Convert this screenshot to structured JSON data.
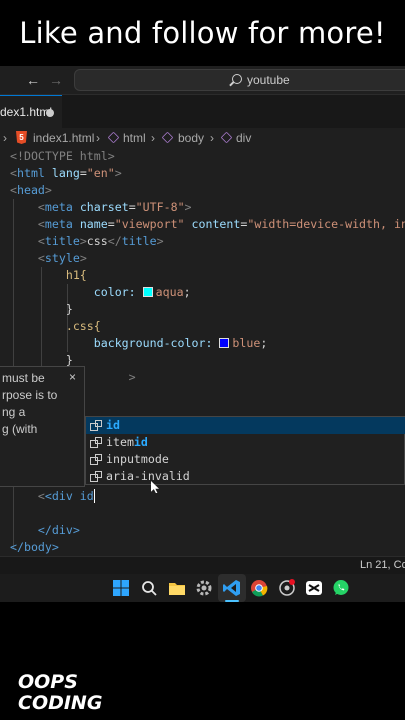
{
  "banner": {
    "text": "Like and follow for more!"
  },
  "titlebar": {
    "search_text": "youtube"
  },
  "tab": {
    "label": "dex1.html"
  },
  "breadcrumb": {
    "file": "index1.html",
    "items": [
      "html",
      "body",
      "div"
    ]
  },
  "code": {
    "doctype": "<!DOCTYPE html>",
    "html_lang": "en",
    "charset": "UTF-8",
    "viewport": "viewport",
    "viewport_content": "width=device-width, in",
    "title": "css",
    "h1_selector": "h1{",
    "h1_prop": "color:",
    "h1_value": "aqua",
    "css_selector": ".css{",
    "css_prop": "background-color:",
    "css_value": "blue",
    "div_line": "<div id",
    "div_close": "</div>",
    "body_close": "</body>"
  },
  "hover": {
    "lines": [
      "must be",
      "rpose is to",
      "ng a",
      "g (with"
    ],
    "close": "×"
  },
  "suggestions": [
    {
      "pre": "",
      "hl": "id",
      "post": ""
    },
    {
      "pre": "item",
      "hl": "id",
      "post": ""
    },
    {
      "pre": "inputmode",
      "hl": "",
      "post": ""
    },
    {
      "pre": "aria-in",
      "hl": "",
      "post": "valid"
    }
  ],
  "status": {
    "position": "Ln 21, Co"
  },
  "brand": {
    "line1": "OOPS",
    "line2": "CODING"
  },
  "colors": {
    "accent": "#0078d4",
    "aqua": "#00ffff",
    "blue": "#0000ff"
  }
}
